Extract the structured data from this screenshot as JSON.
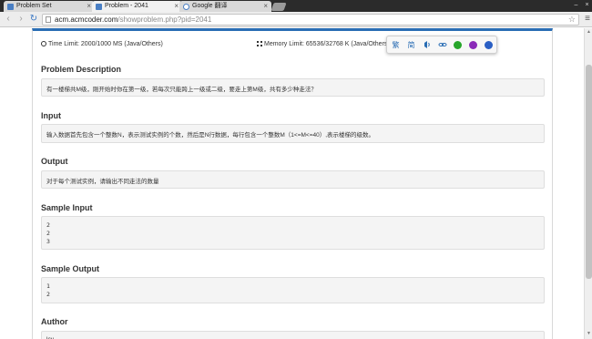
{
  "browser": {
    "tabs": [
      {
        "title": "Problem Set",
        "active": false
      },
      {
        "title": "Problem - 2041",
        "active": true
      },
      {
        "title": "Google 翻译",
        "active": false
      }
    ],
    "close_glyph": "×",
    "url_host": "acm.acmcoder.com",
    "url_path": "/showproblem.php?pid=2041",
    "nav": {
      "back": "‹",
      "forward": "›",
      "reload": "↻",
      "star": "☆",
      "menu": "≡"
    },
    "window_controls": {
      "minimize": "–",
      "close": "×"
    }
  },
  "problem": {
    "time_limit": "Time Limit: 2000/1000 MS (Java/Others)",
    "memory_limit": "Memory Limit: 65536/32768 K (Java/Others)",
    "sections": {
      "description": {
        "title": "Problem Description",
        "text": "有一楼梯共M级，刚开始时你在第一级，若每次只能跨上一级或二级，要走上第M级，共有多少种走法？"
      },
      "input": {
        "title": "Input",
        "text": "输入数据首先包含一个整数N，表示测试实例的个数，然后是N行数据，每行包含一个整数M（1<=M<=40）,表示楼梯的级数。"
      },
      "output": {
        "title": "Output",
        "text": "对于每个测试实例，请输出不同走法的数量"
      },
      "sample_input": {
        "title": "Sample Input",
        "lines": [
          "2",
          "2",
          "3"
        ]
      },
      "sample_output": {
        "title": "Sample Output",
        "lines": [
          "1",
          "2"
        ]
      },
      "author": {
        "title": "Author",
        "text": "lcy"
      }
    }
  },
  "translator_toolbar": {
    "buttons": [
      "繁",
      "简"
    ],
    "icons": [
      "speaker-icon",
      "link-icon",
      "green-orb-icon",
      "purple-orb-icon",
      "blue-orb-icon"
    ],
    "colors": {
      "green": "#27a52a",
      "purple": "#8a2ab8",
      "blue": "#2a5fc4"
    }
  },
  "colors": {
    "accent": "#2a6db4",
    "box_bg": "#f4f4f4"
  }
}
